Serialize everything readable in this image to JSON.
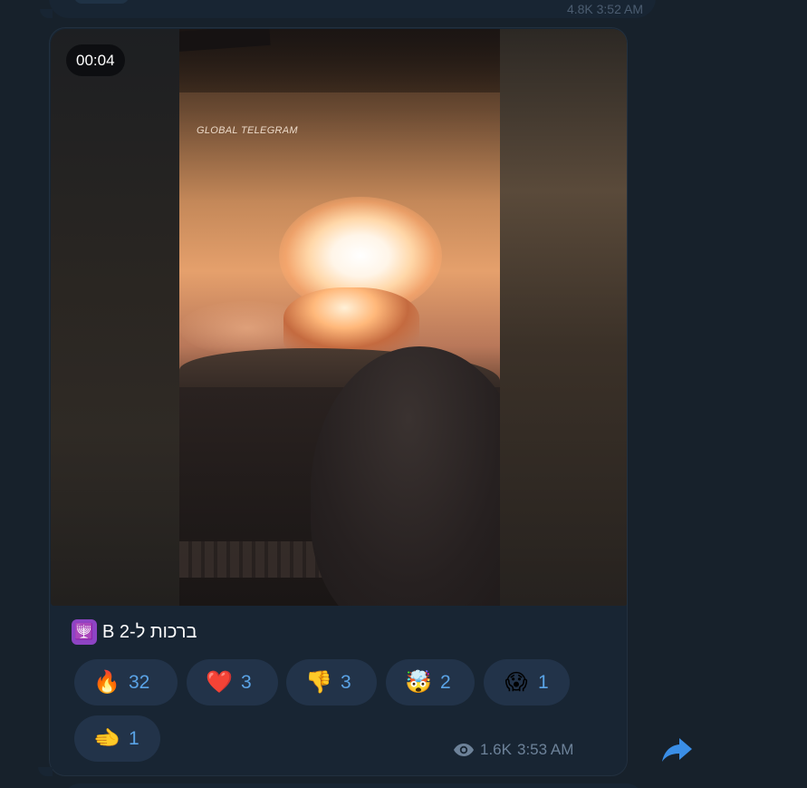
{
  "previous_message": {
    "time": "4.8K 3:52 AM"
  },
  "video": {
    "duration": "00:04",
    "watermark": "GLOBAL TELEGRAM"
  },
  "caption": {
    "emoji": "🕎",
    "text": "ברכות ל-2 B"
  },
  "reactions": [
    {
      "emoji": "🔥",
      "name": "fire-icon",
      "count": "32"
    },
    {
      "emoji": "❤️",
      "name": "heart-icon",
      "count": "3"
    },
    {
      "emoji": "👎",
      "name": "thumbs-down-icon",
      "count": "3"
    },
    {
      "emoji": "🤯",
      "name": "exploding-head-icon",
      "count": "2"
    },
    {
      "emoji": "😱",
      "name": "screaming-face-icon",
      "count": "1"
    },
    {
      "emoji": "🫲",
      "name": "pointing-hand-icon",
      "count": "1"
    }
  ],
  "meta": {
    "views": "1.6K",
    "time": "3:53 AM"
  },
  "colors": {
    "bubble": "#182533",
    "background": "#17212b",
    "accent": "#5aa3e6",
    "reaction_bg": "#223349",
    "meta_text": "#6d8299"
  },
  "icons": {
    "views": "eye-icon",
    "share": "share-arrow-icon"
  }
}
